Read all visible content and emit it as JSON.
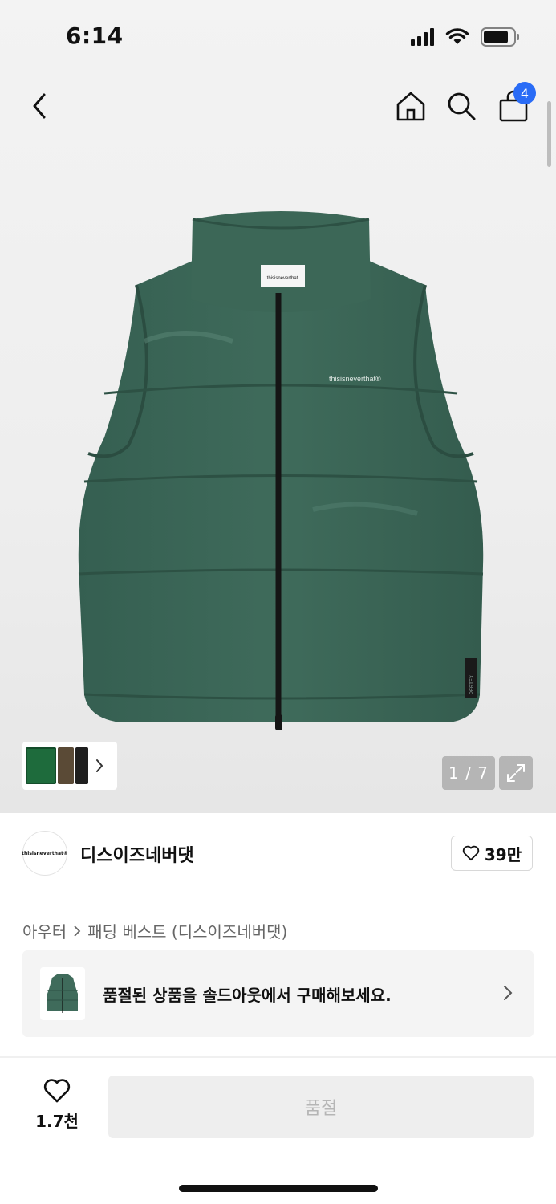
{
  "status_bar": {
    "time": "6:14"
  },
  "nav": {
    "cart_count": "4"
  },
  "gallery": {
    "page_indicator": "1 / 7",
    "label_left": "thisisneverthat",
    "label_chest": "thisisneverthat®",
    "label_side": "PERTEX"
  },
  "brand": {
    "logo_text": "thisisneverthat®",
    "name": "디스이즈네버댓",
    "likes": "39만"
  },
  "breadcrumb": {
    "category": "아우터",
    "subcategory": "패딩 베스트 (디스이즈네버댓)"
  },
  "soldout_banner": {
    "text": "품절된 상품을 솔드아웃에서 구매해보세요."
  },
  "bottom_bar": {
    "like_count": "1.7천",
    "buy_label": "품절"
  },
  "colors": {
    "accent_blue": "#2a6cf6",
    "vest_green": "#3e6a5a",
    "disabled_text": "#b5b5b5"
  },
  "icons": [
    "back-icon",
    "home-icon",
    "search-icon",
    "bag-icon",
    "chevron-right-icon",
    "expand-icon",
    "heart-icon",
    "signal-icon",
    "wifi-icon",
    "battery-icon"
  ]
}
